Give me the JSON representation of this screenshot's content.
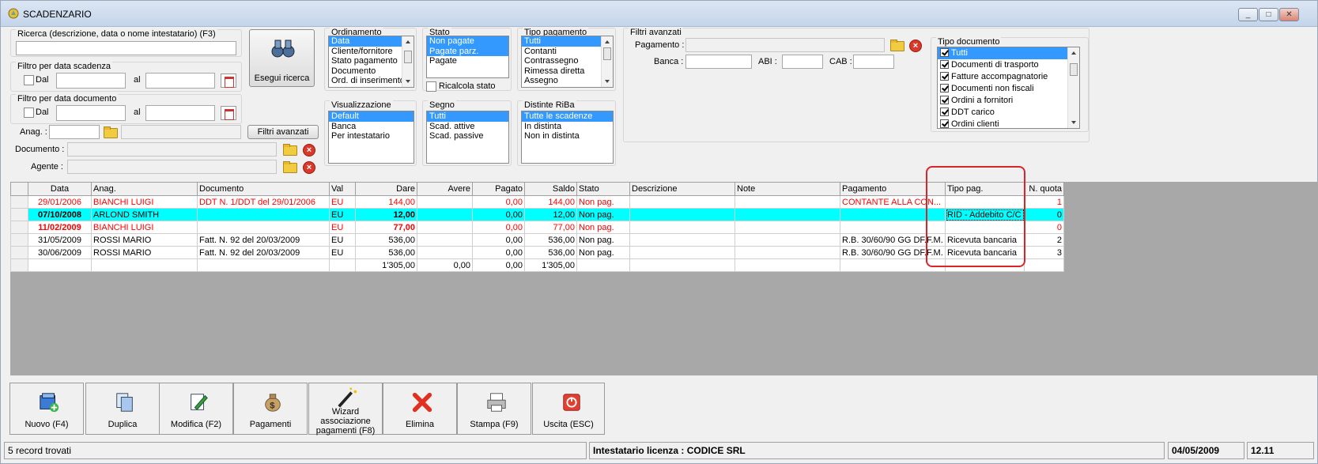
{
  "window": {
    "title": "SCADENZARIO",
    "controls": [
      "_",
      "□",
      "✕"
    ]
  },
  "ricerca": {
    "label": "Ricerca (descrizione, data o nome intestatario) (F3)",
    "value": ""
  },
  "filtro_scadenza": {
    "label": "Filtro per data scadenza",
    "dal": "Dal",
    "al": "al"
  },
  "filtro_documento": {
    "label": "Filtro per data documento",
    "dal": "Dal",
    "al": "al"
  },
  "anag": {
    "label": "Anag. :",
    "filtri_avanzati_btn": "Filtri avanzati"
  },
  "documento": {
    "label": "Documento :"
  },
  "agente": {
    "label": "Agente :"
  },
  "esegui_btn": "Esegui ricerca",
  "ordinamento": {
    "label": "Ordinamento",
    "items": [
      "Data",
      "Cliente/fornitore",
      "Stato pagamento",
      "Documento",
      "Ord. di inserimento"
    ],
    "selected": 0
  },
  "stato": {
    "label": "Stato",
    "items": [
      "Non pagate",
      "Pagate parz.",
      "Pagate"
    ],
    "selected": [
      0,
      1
    ],
    "ricalcola": "Ricalcola stato"
  },
  "tipo_pagamento": {
    "label": "Tipo pagamento",
    "items": [
      "Tutti",
      "Contanti",
      "Contrassegno",
      "Rimessa diretta",
      "Assegno"
    ],
    "selected": 0
  },
  "visualizzazione": {
    "label": "Visualizzazione",
    "items": [
      "Default",
      "Banca",
      "Per intestatario"
    ],
    "selected": 0
  },
  "segno": {
    "label": "Segno",
    "items": [
      "Tutti",
      "Scad. attive",
      "Scad. passive"
    ],
    "selected": 0
  },
  "distinte": {
    "label": "Distinte RiBa",
    "items": [
      "Tutte le scadenze",
      "In distinta",
      "Non in distinta"
    ],
    "selected": 0
  },
  "filtri_avanzati": {
    "label": "Filtri avanzati",
    "pagamento": "Pagamento :",
    "banca": "Banca :",
    "abi": "ABI :",
    "cab": "CAB :"
  },
  "tipo_documento": {
    "label": "Tipo documento",
    "items": [
      "Tutti",
      "Documenti di trasporto",
      "Fatture accompagnatorie",
      "Documenti non fiscali",
      "Ordini a fornitori",
      "DDT carico",
      "Ordini clienti"
    ],
    "selected": 0
  },
  "table": {
    "columns": [
      "Data",
      "Anag.",
      "Documento",
      "Val",
      "Dare",
      "Avere",
      "Pagato",
      "Saldo",
      "Stato",
      "Descrizione",
      "Note",
      "Pagamento",
      "Tipo pag.",
      "N. quota"
    ],
    "rows": [
      {
        "style": "red",
        "cells": [
          "29/01/2006",
          "BIANCHI LUIGI",
          "DDT N. 1/DDT del 29/01/2006",
          "EU",
          "144,00",
          "",
          "0,00",
          "144,00",
          "Non pag.",
          "",
          "",
          "CONTANTE ALLA CON...",
          "",
          "1"
        ]
      },
      {
        "style": "selected",
        "cells": [
          "07/10/2008",
          "ARLOND SMITH",
          "",
          "EU",
          "12,00",
          "",
          "0,00",
          "12,00",
          "Non pag.",
          "",
          "",
          "",
          "RID - Addebito C/C",
          "0"
        ]
      },
      {
        "style": "redbold",
        "cells": [
          "11/02/2009",
          "BIANCHI LUIGI",
          "",
          "EU",
          "77,00",
          "",
          "0,00",
          "77,00",
          "Non pag.",
          "",
          "",
          "",
          "",
          "0"
        ]
      },
      {
        "style": "normal",
        "cells": [
          "31/05/2009",
          "ROSSI MARIO",
          "Fatt. N. 92 del 20/03/2009",
          "EU",
          "536,00",
          "",
          "0,00",
          "536,00",
          "Non pag.",
          "",
          "",
          "R.B. 30/60/90 GG DF.F.M.",
          "Ricevuta bancaria",
          "2"
        ]
      },
      {
        "style": "normal",
        "cells": [
          "30/06/2009",
          "ROSSI MARIO",
          "Fatt. N. 92 del 20/03/2009",
          "EU",
          "536,00",
          "",
          "0,00",
          "536,00",
          "Non pag.",
          "",
          "",
          "R.B. 30/60/90 GG DF.F.M.",
          "Ricevuta bancaria",
          "3"
        ]
      },
      {
        "style": "total",
        "cells": [
          "",
          "",
          "",
          "",
          "1'305,00",
          "0,00",
          "0,00",
          "1'305,00",
          "",
          "",
          "",
          "",
          "",
          ""
        ]
      }
    ]
  },
  "toolbar": [
    {
      "label": "Nuovo (F4)",
      "icon": "new-record-icon"
    },
    {
      "label": "Duplica",
      "icon": "duplicate-icon"
    },
    {
      "label": "Modifica (F2)",
      "icon": "edit-icon"
    },
    {
      "label": "Pagamenti",
      "icon": "money-bag-icon"
    },
    {
      "label": "Wizard associazione pagamenti (F8)",
      "icon": "wizard-wand-icon"
    },
    {
      "label": "Elimina",
      "icon": "delete-x-icon"
    },
    {
      "label": "Stampa (F9)",
      "icon": "printer-icon"
    },
    {
      "label": "Uscita (ESC)",
      "icon": "exit-icon"
    }
  ],
  "status": {
    "records": "5 record trovati",
    "licenza": "Intestatario licenza : CODICE SRL",
    "date": "04/05/2009",
    "time": "12.11"
  },
  "colors": {
    "selected_row": "#00ffff",
    "red_text": "#ff0000",
    "highlight": "#d9242a"
  }
}
